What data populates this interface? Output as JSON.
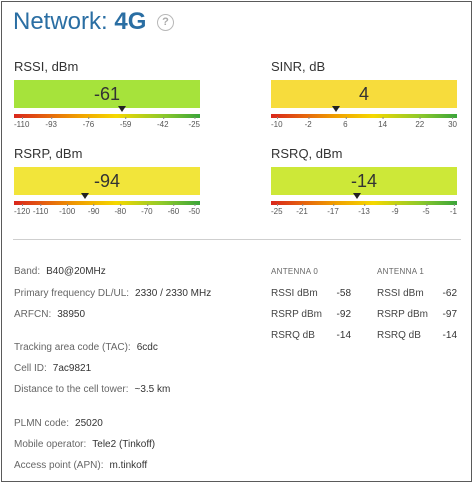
{
  "title": {
    "prefix": "Network:",
    "tech": "4G",
    "help": "?"
  },
  "metrics": [
    {
      "label": "RSSI, dBm",
      "value": "-61",
      "color": "#a6e33b",
      "ticks": [
        "-110",
        "-93",
        "-76",
        "-59",
        "-42",
        "-25"
      ],
      "marker_fraction": 0.58
    },
    {
      "label": "SINR, dB",
      "value": "4",
      "color": "#f7dc3c",
      "ticks": [
        "-10",
        "-2",
        "6",
        "14",
        "22",
        "30"
      ],
      "marker_fraction": 0.35
    },
    {
      "label": "RSRP, dBm",
      "value": "-94",
      "color": "#f2e53a",
      "ticks": [
        "-120",
        "-110",
        "-100",
        "-90",
        "-80",
        "-70",
        "-60",
        "-50"
      ],
      "marker_fraction": 0.38
    },
    {
      "label": "RSRQ, dBm",
      "value": "-14",
      "color": "#cde838",
      "ticks": [
        "-25",
        "-21",
        "-17",
        "-13",
        "-9",
        "-5",
        "-1"
      ],
      "marker_fraction": 0.46
    }
  ],
  "info": {
    "band_label": "Band:",
    "band_value": "B40@20MHz",
    "freq_label": "Primary frequency DL/UL:",
    "freq_value": "2330 / 2330 MHz",
    "arfcn_label": "ARFCN:",
    "arfcn_value": "38950",
    "tac_label": "Tracking area code (TAC):",
    "tac_value": "6cdc",
    "cell_label": "Cell ID:",
    "cell_value": "7ac9821",
    "dist_label": "Distance to the cell tower:",
    "dist_value": "~3.5 km",
    "plmn_label": "PLMN code:",
    "plmn_value": "25020",
    "op_label": "Mobile operator:",
    "op_value": "Tele2 (Tinkoff)",
    "apn_label": "Access point (APN):",
    "apn_value": "m.tinkoff"
  },
  "antennas": [
    {
      "name": "ANTENNA 0",
      "rows": [
        {
          "k": "RSSI dBm",
          "v": "-58"
        },
        {
          "k": "RSRP dBm",
          "v": "-92"
        },
        {
          "k": "RSRQ dB",
          "v": "-14"
        }
      ]
    },
    {
      "name": "ANTENNA 1",
      "rows": [
        {
          "k": "RSSI dBm",
          "v": "-62"
        },
        {
          "k": "RSRP dBm",
          "v": "-97"
        },
        {
          "k": "RSRQ dB",
          "v": "-14"
        }
      ]
    }
  ]
}
